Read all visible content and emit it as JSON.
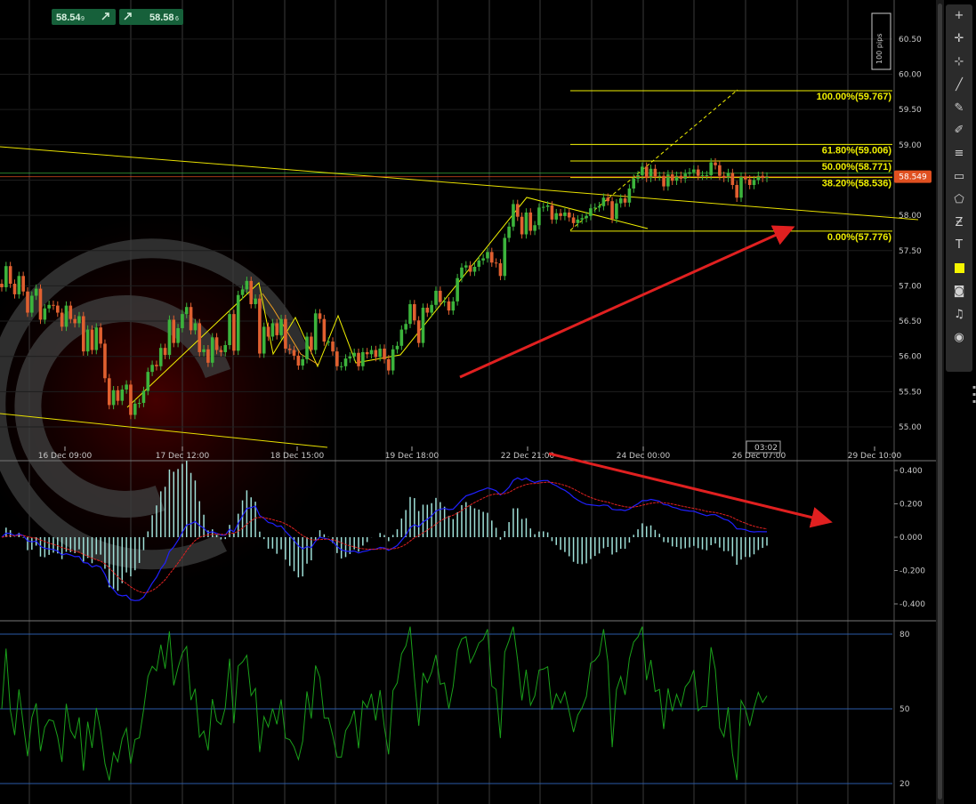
{
  "quote_buttons": {
    "sell_price": "58.54",
    "sell_superscript": "9",
    "buy_price": "58.58",
    "buy_superscript": "6",
    "sell_icon": "arrow-up-right-icon",
    "buy_icon": "arrow-up-right-icon"
  },
  "scale_indicator": "100 pips",
  "current_price_tag": "58.549",
  "time_cursor_label": "03:02",
  "colors": {
    "background": "#000000",
    "grid": "#3a3a3a",
    "candle_up": "#3cb43c",
    "candle_down": "#e06030",
    "fib": "#f0f000",
    "trend": "#e8e000",
    "annotation_arrow": "#e02020",
    "macd_line": "#2020ff",
    "signal_line": "#e02020",
    "histogram": "#9fe0d8",
    "rsi": "#1aa01a",
    "price_tag": "#e05020"
  },
  "toolbar": {
    "tools": [
      "crosshair-icon",
      "crosshair-plus-icon",
      "cursor-plus-icon",
      "trend-line-icon",
      "pencil-icon",
      "brush-icon",
      "fibonacci-icon",
      "rectangle-icon",
      "shape-icon",
      "z-arrow-icon",
      "text-icon",
      "color-swatch-icon",
      "camera-icon",
      "alert-bell-icon",
      "replay-icon"
    ],
    "text_tool_label": "T"
  },
  "chart_data": [
    {
      "type": "line",
      "title": "",
      "subtitle": "candlestick price chart",
      "y_range": [
        54.8,
        60.8
      ],
      "y_ticks": [
        "55.00",
        "55.50",
        "56.00",
        "56.50",
        "57.00",
        "57.50",
        "58.00",
        "58.50",
        "59.00",
        "59.50",
        "60.00",
        "60.50"
      ],
      "x_ticks": [
        "16 Dec 09:00",
        "17 Dec 12:00",
        "18 Dec 15:00",
        "19 Dec 18:00",
        "22 Dec 21:00",
        "24 Dec 00:00",
        "26 Dec 07:00",
        "29 Dec 10:00"
      ],
      "close_series": [
        56.98,
        57.28,
        57.03,
        56.88,
        57.14,
        56.92,
        56.62,
        56.86,
        56.96,
        56.52,
        56.68,
        56.73,
        56.72,
        56.62,
        56.42,
        56.72,
        56.53,
        56.47,
        56.57,
        56.07,
        56.38,
        56.09,
        56.41,
        56.18,
        55.69,
        55.31,
        55.52,
        55.37,
        55.53,
        55.6,
        55.17,
        55.33,
        55.34,
        55.51,
        55.78,
        55.88,
        55.86,
        56.12,
        56.02,
        56.52,
        56.19,
        56.4,
        56.6,
        56.7,
        56.37,
        56.47,
        56.06,
        56.1,
        55.91,
        56.27,
        56.09,
        56.06,
        56.16,
        56.6,
        56.08,
        56.87,
        56.95,
        57.07,
        56.74,
        56.82,
        56.04,
        56.42,
        56.28,
        56.47,
        56.3,
        56.53,
        56.11,
        56.09,
        56.01,
        55.87,
        55.96,
        56.28,
        56.09,
        56.61,
        56.53,
        56.21,
        56.21,
        56.07,
        55.86,
        55.86,
        55.97,
        56.0,
        56.05,
        55.86,
        56.06,
        56.03,
        56.09,
        55.99,
        56.11,
        55.96,
        55.8,
        56.1,
        56.15,
        56.38,
        56.46,
        56.74,
        56.51,
        56.19,
        56.69,
        56.62,
        56.73,
        56.93,
        56.77,
        56.78,
        56.65,
        56.78,
        57.11,
        57.26,
        57.29,
        57.2,
        57.27,
        57.36,
        57.39,
        57.48,
        57.33,
        57.32,
        57.14,
        57.68,
        57.84,
        58.16,
        57.98,
        57.73,
        58.04,
        57.78,
        57.86,
        58.11,
        58.12,
        58.14,
        57.94,
        58.03,
        57.99,
        58.04,
        57.97,
        57.89,
        57.94,
        57.96,
        57.99,
        58.1,
        58.11,
        58.13,
        58.25,
        58.2,
        57.95,
        58.17,
        58.24,
        58.18,
        58.38,
        58.52,
        58.57,
        58.69,
        58.53,
        58.66,
        58.55,
        58.56,
        58.41,
        58.58,
        58.49,
        58.56,
        58.52,
        58.59,
        58.61,
        58.65,
        58.56,
        58.57,
        58.57,
        58.75,
        58.71,
        58.56,
        58.53,
        58.6,
        58.43,
        58.25,
        58.55,
        58.51,
        58.43,
        58.5,
        58.56,
        58.53,
        58.55
      ],
      "last_price": 58.549,
      "fibonacci": [
        {
          "label": "100.00%(59.767)",
          "value": 59.767
        },
        {
          "label": "61.80%(59.006)",
          "value": 59.006
        },
        {
          "label": "50.00%(58.771)",
          "value": 58.771
        },
        {
          "label": "38.20%(58.536)",
          "value": 58.536
        },
        {
          "label": "0.00%(57.776)",
          "value": 57.776
        }
      ],
      "grid": true
    },
    {
      "type": "line",
      "subtitle": "MACD",
      "y_range": [
        -0.48,
        0.44
      ],
      "y_ticks": [
        "0.400",
        "0.200",
        "0.000",
        "-0.200",
        "-0.400"
      ],
      "grid": true
    },
    {
      "type": "line",
      "subtitle": "RSI",
      "y_range": [
        11,
        85
      ],
      "y_ticks": [
        "80",
        "50",
        "20"
      ],
      "levels": [
        80,
        50,
        20
      ],
      "grid": true
    }
  ]
}
